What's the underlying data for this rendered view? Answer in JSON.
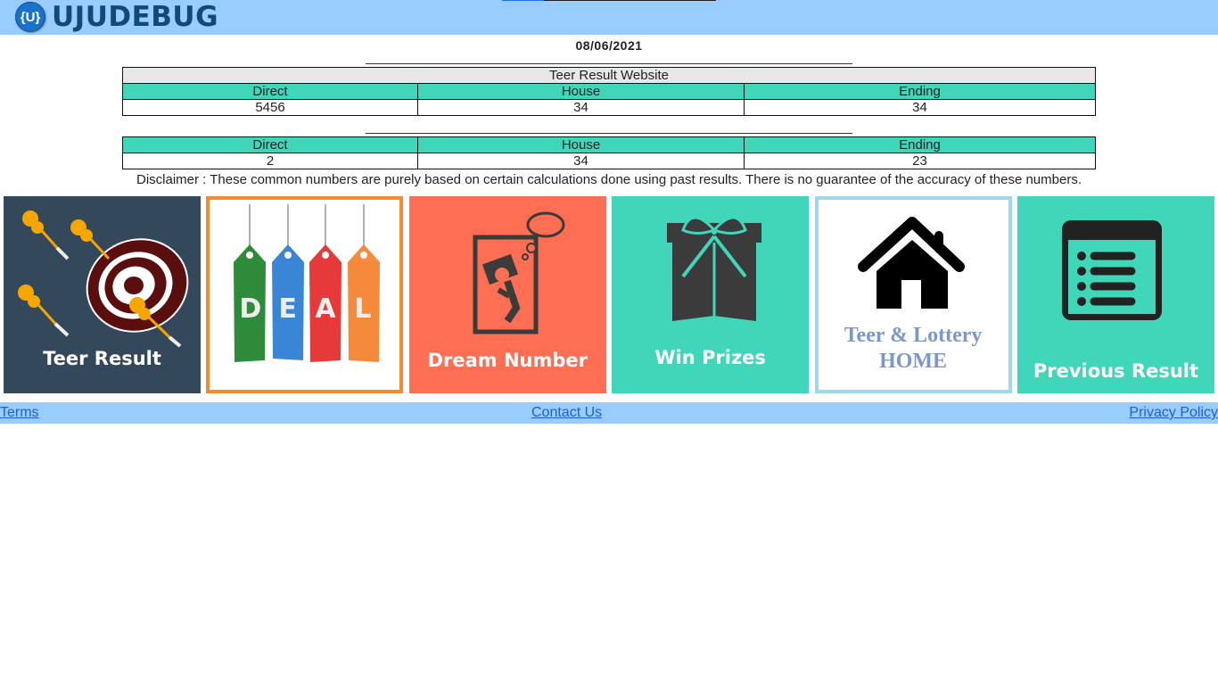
{
  "header": {
    "logo_badge": "{U}",
    "logo_text": "UJUDEBUG",
    "colors": {
      "bar": "#99ccff",
      "logo_text": "#0f4a78"
    }
  },
  "date": "08/06/2021",
  "result_table": {
    "caption": "Teer Result Website",
    "columns": [
      "Direct",
      "House",
      "Ending"
    ],
    "values": [
      "5456",
      "34",
      "34"
    ]
  },
  "common_table": {
    "columns": [
      "Direct",
      "House",
      "Ending"
    ],
    "values": [
      "2",
      "34",
      "23"
    ]
  },
  "disclaimer": "Disclaimer : These common numbers are purely based on certain calculations done using past results. There is no guarantee of the accuracy of these numbers.",
  "tiles": [
    {
      "label": "Teer Result",
      "icon": "dartboard-icon",
      "color": "#34485c"
    },
    {
      "label": "DEAL",
      "icon": "price-tags-icon",
      "letters": [
        "D",
        "E",
        "A",
        "L"
      ],
      "color": "#f58a2e"
    },
    {
      "label": "Dream Number",
      "icon": "sleeping-person-icon",
      "color": "#fd6e53"
    },
    {
      "label": "Win Prizes",
      "icon": "gift-box-icon",
      "color": "#40d6b9"
    },
    {
      "label_line1": "Teer & Lottery",
      "label_line2": "HOME",
      "icon": "house-icon",
      "color": "#9fd8ea"
    },
    {
      "label": "Previous Result",
      "icon": "list-icon",
      "color": "#40d6b9"
    }
  ],
  "footer": {
    "terms": "Terms",
    "contact": "Contact Us",
    "privacy": "Privacy Policy"
  },
  "accent_color": "#40d6b9"
}
